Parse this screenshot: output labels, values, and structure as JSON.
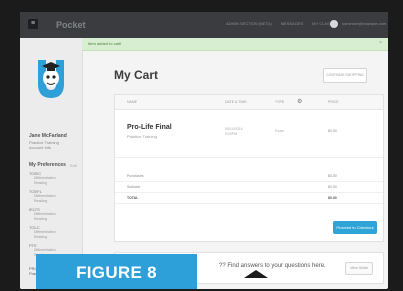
{
  "topbar": {
    "brand": "Pocket",
    "nav": [
      "ADMIN SECTION (BETA)",
      "MESSAGES",
      "MY CLASS"
    ],
    "account": "someone@example.com"
  },
  "sidebar": {
    "user_name": "Jane McFarland",
    "user_sub": [
      "Practice Training",
      "Account Info"
    ],
    "preferences_title": "My Preferences",
    "preferences_edit": "Edit",
    "groups": [
      {
        "label": "TOEIC",
        "items": [
          "Differentiation",
          "Reading"
        ]
      },
      {
        "label": "TOEFL",
        "items": [
          "Differentiation",
          "Reading"
        ]
      },
      {
        "label": "IELTS",
        "items": [
          "Differentiation",
          "Reading"
        ]
      },
      {
        "label": "TOLC",
        "items": [
          "Differentiation",
          "Reading"
        ]
      },
      {
        "label": "PTE",
        "items": [
          "Differentiation",
          "Reading"
        ]
      }
    ],
    "bottom": [
      "PRISM",
      "Practice Training"
    ]
  },
  "banner": {
    "message": "Item added to cart!",
    "close": "×"
  },
  "page": {
    "title": "My Cart",
    "continue_label": "CONTINUE SHOPPING"
  },
  "cart": {
    "headers": {
      "name": "NAME",
      "date": "DATE & TIME",
      "type": "TYPE",
      "price": "PRICE"
    },
    "item": {
      "name": "Pro-Life Final",
      "sub": "Practice Training",
      "date": [
        "09/14/2014",
        "9:00PM"
      ],
      "type": "Exam",
      "price": "$0.00"
    },
    "summary": [
      {
        "label": "Purchases",
        "value": "$0.00"
      },
      {
        "label": "Subtotal",
        "value": "$0.00"
      },
      {
        "label": "TOTAL",
        "value": "$0.00"
      }
    ],
    "checkout_label": "Proceed to Checkout"
  },
  "help": {
    "text": "?? Find answers to your questions here.",
    "button": "View Guide"
  },
  "figure_label": "FIGURE 8",
  "colors": {
    "accent": "#2fa4d6",
    "topbar": "#3a3c3f",
    "banner": "#d7efd0"
  }
}
